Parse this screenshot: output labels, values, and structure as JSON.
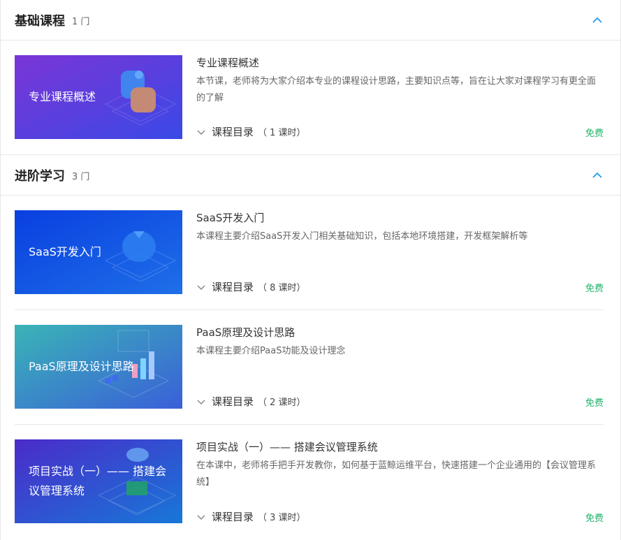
{
  "sections": [
    {
      "title": "基础课程",
      "count": "1 门",
      "courses": [
        {
          "thumb_text": "专业课程概述",
          "title": "专业课程概述",
          "desc": "本节课，老师将为大家介绍本专业的课程设计思路，主要知识点等，旨在让大家对课程学习有更全面的了解",
          "toc_label": "课程目录",
          "toc_count": "（ 1 课时）",
          "price": "免费"
        }
      ]
    },
    {
      "title": "进阶学习",
      "count": "3 门",
      "courses": [
        {
          "thumb_text": "SaaS开发入门",
          "title": "SaaS开发入门",
          "desc": "本课程主要介绍SaaS开发入门相关基础知识，包括本地环境搭建，开发框架解析等",
          "toc_label": "课程目录",
          "toc_count": "（ 8 课时）",
          "price": "免费"
        },
        {
          "thumb_text": "PaaS原理及设计思路",
          "title": "PaaS原理及设计思路",
          "desc": "本课程主要介绍PaaS功能及设计理念",
          "toc_label": "课程目录",
          "toc_count": "（ 2 课时）",
          "price": "免费"
        },
        {
          "thumb_text": "项目实战（一）—— 搭建会议管理系统",
          "title": "项目实战（一）—— 搭建会议管理系统",
          "desc": "在本课中，老师将手把手开发教你，如何基于蓝鲸运维平台，快速搭建一个企业通用的【会议管理系统】",
          "toc_label": "课程目录",
          "toc_count": "（ 3 课时）",
          "price": "免费"
        }
      ]
    }
  ],
  "colors": {
    "accent": "#1d9bf0",
    "price": "#20b36a",
    "thumb1": [
      "#7b35d6",
      "#3a49e6"
    ],
    "thumb2": [
      "#0a3fe0",
      "#1e6fe8"
    ],
    "thumb3": [
      "#3ab4b7",
      "#3a5fd8"
    ],
    "thumb4": [
      "#4b2bc9",
      "#1777d8"
    ]
  }
}
